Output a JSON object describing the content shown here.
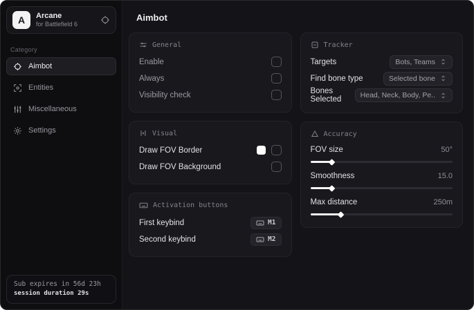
{
  "brand": {
    "logo_letter": "A",
    "title": "Arcane",
    "subtitle": "for Battlefield 6"
  },
  "sidebar": {
    "category_label": "Category",
    "items": [
      {
        "label": "Aimbot",
        "icon": "crosshair-icon",
        "active": true
      },
      {
        "label": "Entities",
        "icon": "scan-icon",
        "active": false
      },
      {
        "label": "Miscellaneous",
        "icon": "sliders-vertical-icon",
        "active": false
      },
      {
        "label": "Settings",
        "icon": "gear-icon",
        "active": false
      }
    ],
    "subscription": {
      "line1": "Sub expires in 56d 23h",
      "line2": "session duration 29s"
    }
  },
  "main": {
    "title": "Aimbot",
    "general": {
      "title": "General",
      "rows": [
        {
          "label": "Enable"
        },
        {
          "label": "Always"
        },
        {
          "label": "Visibility check"
        }
      ],
      "checked": [
        false,
        false,
        false
      ]
    },
    "visual": {
      "title": "Visual",
      "rows": [
        {
          "label": "Draw FOV Border",
          "swatch_color": "#ffffff",
          "swatch_style": "background:#ffffff"
        },
        {
          "label": "Draw FOV Background"
        }
      ]
    },
    "activation": {
      "title": "Activation buttons",
      "rows": [
        {
          "label": "First keybind",
          "key": "M1"
        },
        {
          "label": "Second keybind",
          "key": "M2"
        }
      ]
    },
    "tracker": {
      "title": "Tracker",
      "rows": [
        {
          "label": "Targets",
          "value": "Bots, Teams"
        },
        {
          "label": "Find bone type",
          "value": "Selected bone"
        },
        {
          "label": "Bones Selected",
          "value": "Head, Neck, Body, Pe.."
        }
      ]
    },
    "accuracy": {
      "title": "Accuracy",
      "sliders": [
        {
          "label": "FOV size",
          "value": "50°",
          "fill_pct": 15,
          "fill_style": "width:15%"
        },
        {
          "label": "Smoothness",
          "value": "15.0",
          "fill_pct": 15,
          "fill_style": "width:15%"
        },
        {
          "label": "Max distance",
          "value": "250m",
          "fill_pct": 21,
          "fill_style": "width:21%"
        }
      ],
      "fill_color": "#ffffff"
    }
  }
}
